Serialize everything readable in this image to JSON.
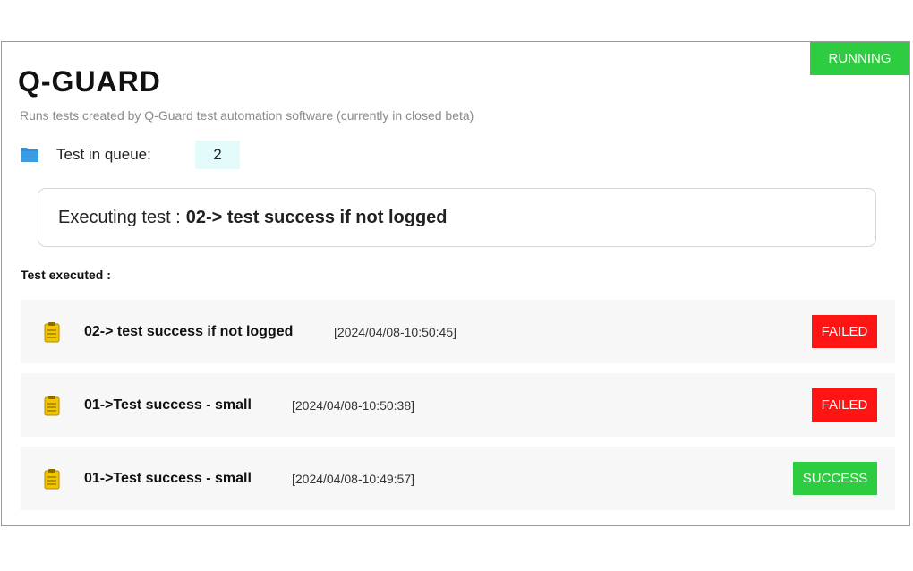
{
  "app": {
    "status": "RUNNING",
    "logo_text": "Q-GUARD",
    "subtitle": "Runs tests created by Q-Guard test automation software (currently in closed beta)"
  },
  "queue": {
    "label": "Test in queue:",
    "count": "2"
  },
  "executing": {
    "prefix": "Executing test :",
    "test_name": "02-> test success if not logged"
  },
  "executed": {
    "title": "Test executed :",
    "rows": [
      {
        "name": "02-> test success if not logged",
        "time": "[2024/04/08-10:50:45]",
        "status": "FAILED"
      },
      {
        "name": "01->Test success - small",
        "time": "[2024/04/08-10:50:38]",
        "status": "FAILED"
      },
      {
        "name": "01->Test success - small",
        "time": "[2024/04/08-10:49:57]",
        "status": "SUCCESS"
      }
    ]
  },
  "colors": {
    "running": "#2ecc40",
    "failed": "#ff1414",
    "success": "#2ecc40",
    "queue_bg": "#e3fbfb",
    "logo_accent": "#6a3fd0"
  },
  "icons": {
    "queue": "folder-icon",
    "result": "clipboard-icon"
  }
}
